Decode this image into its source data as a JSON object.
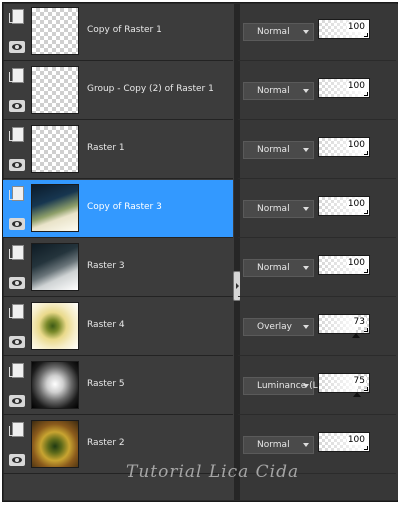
{
  "layers": [
    {
      "name": "Copy of Raster 1",
      "blend_mode": "Normal",
      "opacity": "100",
      "selected": false,
      "thumb": "transparent"
    },
    {
      "name": "Group - Copy (2) of Raster 1",
      "blend_mode": "Normal",
      "opacity": "100",
      "selected": false,
      "thumb": "transparent"
    },
    {
      "name": "Raster 1",
      "blend_mode": "Normal",
      "opacity": "100",
      "selected": false,
      "thumb": "transparent"
    },
    {
      "name": "Copy of Raster 3",
      "blend_mode": "Normal",
      "opacity": "100",
      "selected": true,
      "thumb": "landscape-dark"
    },
    {
      "name": "Raster 3",
      "blend_mode": "Normal",
      "opacity": "100",
      "selected": false,
      "thumb": "landscape-dark2"
    },
    {
      "name": "Raster 4",
      "blend_mode": "Overlay",
      "opacity": "73",
      "selected": false,
      "thumb": "flowers-light"
    },
    {
      "name": "Raster 5",
      "blend_mode": "Luminance (L)",
      "opacity": "75",
      "selected": false,
      "thumb": "bw-cloud"
    },
    {
      "name": "Raster 2",
      "blend_mode": "Normal",
      "opacity": "100",
      "selected": false,
      "thumb": "flowers-orange"
    }
  ],
  "colors": {
    "selected_row": "#3399ff",
    "panel_bg": "#3c3c3c",
    "right_bg": "#373737"
  },
  "watermark": "Tutorial Lica Cida"
}
